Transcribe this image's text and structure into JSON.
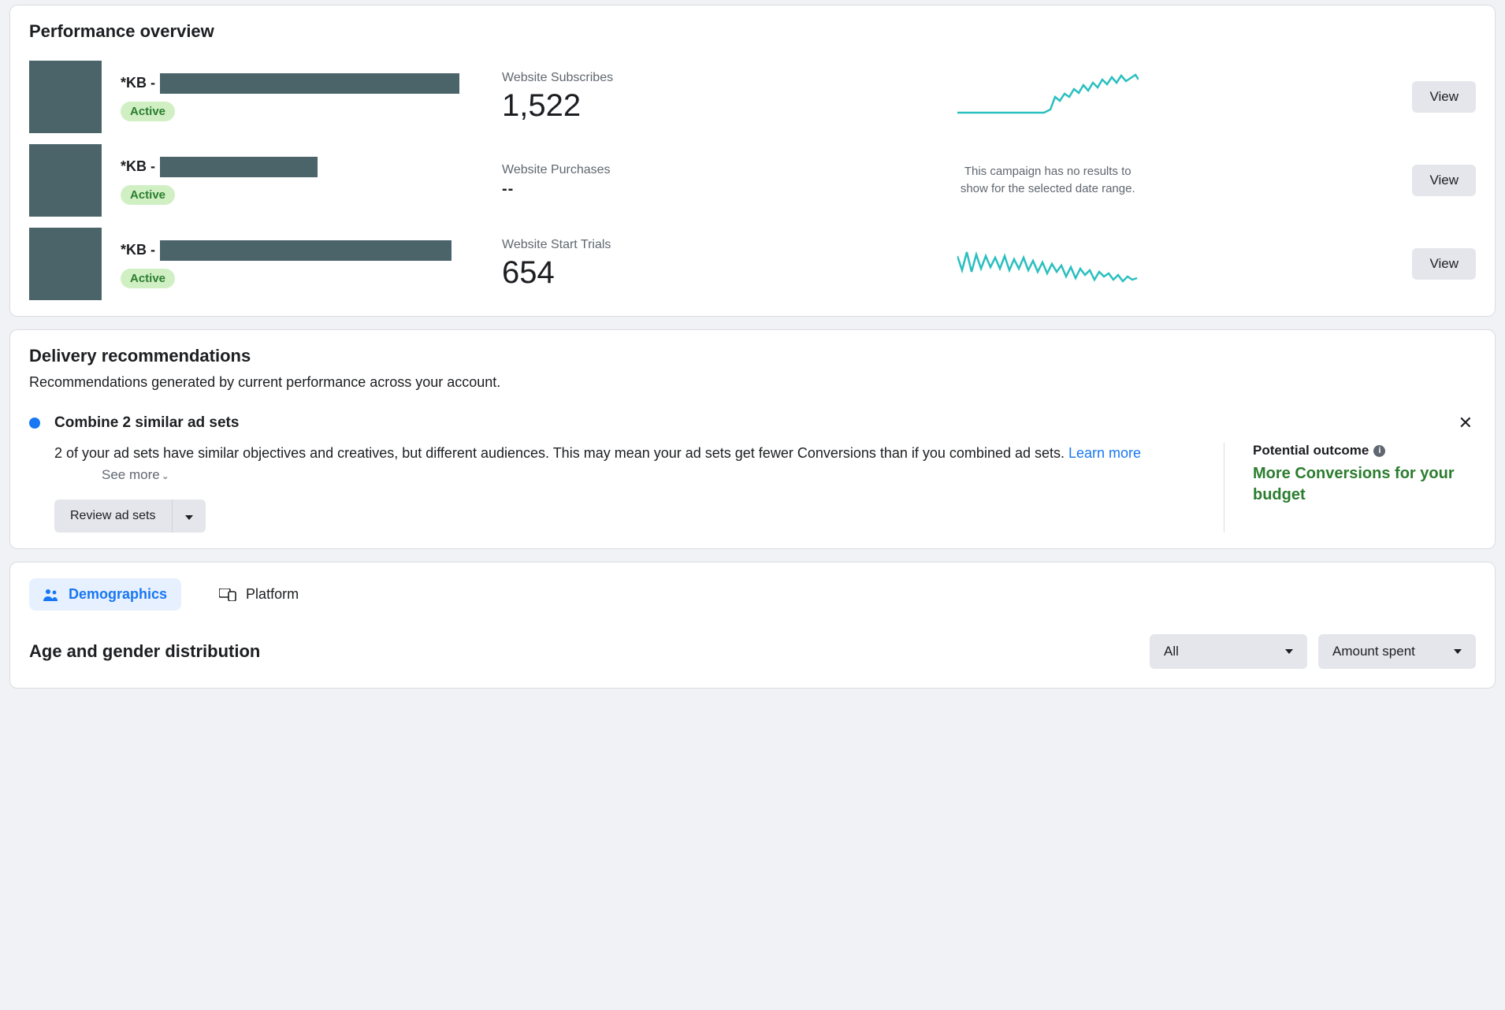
{
  "performance": {
    "title": "Performance overview",
    "rows": [
      {
        "name_prefix": "*KB -",
        "status": "Active",
        "metric_label": "Website Subscribes",
        "metric_value": "1,522",
        "has_chart": true,
        "view_label": "View"
      },
      {
        "name_prefix": "*KB -",
        "status": "Active",
        "metric_label": "Website Purchases",
        "metric_value": "--",
        "has_chart": false,
        "no_chart_msg": "This campaign has no results to show for the selected date range.",
        "view_label": "View"
      },
      {
        "name_prefix": "*KB -",
        "status": "Active",
        "metric_label": "Website Start Trials",
        "metric_value": "654",
        "has_chart": true,
        "view_label": "View"
      }
    ]
  },
  "delivery": {
    "title": "Delivery recommendations",
    "subtitle": "Recommendations generated by current performance across your account.",
    "item": {
      "title": "Combine 2 similar ad sets",
      "description_a": "2 of your ad sets have similar objectives and creatives, but different audiences. This may mean your ad sets get fewer Conversions than if you combined ad sets. ",
      "learn_more": "Learn more",
      "see_more": "See more",
      "review_label": "Review ad sets",
      "potential_label": "Potential outcome",
      "potential_value": "More Conversions for your budget"
    }
  },
  "breakdown": {
    "tabs": {
      "demographics": "Demographics",
      "platform": "Platform"
    },
    "dist_title": "Age and gender distribution",
    "filter1": "All",
    "filter2": "Amount spent"
  },
  "chart_data": [
    {
      "type": "line",
      "title": "Website Subscribes sparkline",
      "series": [
        {
          "name": "subscribes",
          "values": [
            0,
            0,
            0,
            0,
            0,
            0,
            0,
            0,
            0,
            0,
            0,
            0,
            1,
            4,
            10,
            12,
            8,
            14,
            16,
            12,
            18,
            20,
            17,
            22,
            25,
            20,
            27,
            30,
            26,
            32
          ]
        }
      ],
      "xlabel": "",
      "ylabel": "",
      "ylim": [
        0,
        35
      ]
    },
    {
      "type": "line",
      "title": "Website Start Trials sparkline",
      "series": [
        {
          "name": "trials",
          "values": [
            22,
            14,
            25,
            12,
            24,
            13,
            23,
            15,
            22,
            14,
            23,
            13,
            21,
            12,
            20,
            14,
            19,
            11,
            18,
            10,
            17,
            12,
            15,
            9,
            14,
            8,
            13,
            11,
            12,
            10
          ]
        }
      ],
      "xlabel": "",
      "ylabel": "",
      "ylim": [
        0,
        30
      ]
    }
  ]
}
